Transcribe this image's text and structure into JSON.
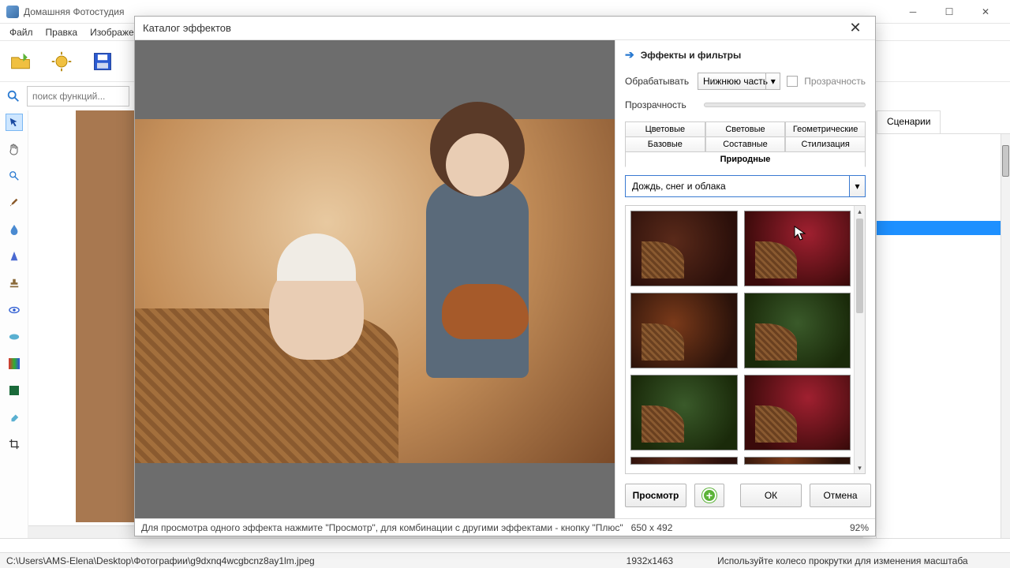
{
  "app": {
    "title": "Домашняя Фотостудия"
  },
  "menu": {
    "file": "Файл",
    "edit": "Правка",
    "image": "Изображени"
  },
  "search": {
    "placeholder": "поиск функций..."
  },
  "right_tabs": {
    "scenarios": "Сценарии"
  },
  "dialog": {
    "title": "Каталог эффектов",
    "section": "Эффекты и фильтры",
    "process_label": "Обрабатывать",
    "process_value": "Нижнюю часть",
    "transparency_chk": "Прозрачность",
    "opacity_label": "Прозрачность",
    "tabs": {
      "color": "Цветовые",
      "light": "Световые",
      "geom": "Геометрические",
      "basic": "Базовые",
      "composite": "Составные",
      "stylize": "Стилизация",
      "nature": "Природные"
    },
    "effect_group": "Дождь, снег и облака",
    "buttons": {
      "preview": "Просмотр",
      "ok": "ОК",
      "cancel": "Отмена"
    },
    "hint": "Для просмотра одного эффекта нажмите \"Просмотр\", для комбинации с другими эффектами - кнопку \"Плюс\"",
    "preview_dims": "650 x 492",
    "zoom": "92%"
  },
  "status": {
    "filepath": "C:\\Users\\AMS-Elena\\Desktop\\Фотографии\\g9dxnq4wcgbcnz8ay1lm.jpeg",
    "dims": "1932x1463",
    "hint": "Используйте колесо прокрутки для изменения масштаба"
  }
}
